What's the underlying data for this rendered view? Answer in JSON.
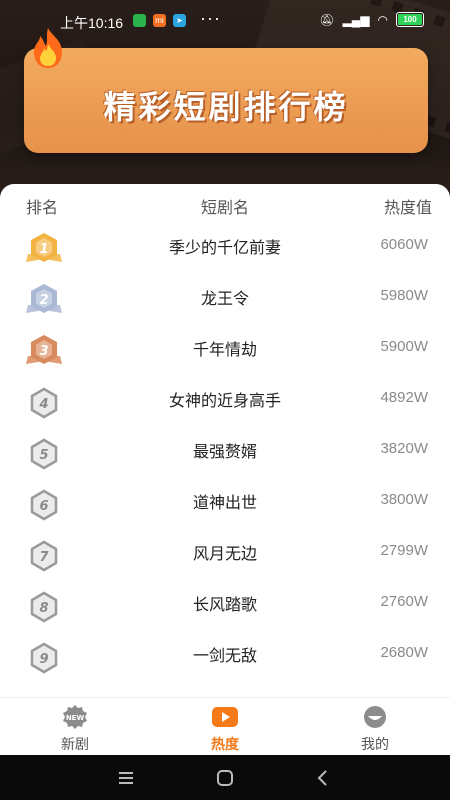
{
  "status_bar": {
    "time": "上午10:16",
    "battery": "100",
    "app_icons": [
      {
        "name": "messages-icon",
        "color": "#2bb24c"
      },
      {
        "name": "mi-icon",
        "color": "#f26f21",
        "text": "mi"
      },
      {
        "name": "telegram-icon",
        "color": "#2aa3e0"
      }
    ],
    "more": "···"
  },
  "banner": {
    "title": "精彩短剧排行榜"
  },
  "table": {
    "headers": {
      "rank": "排名",
      "name": "短剧名",
      "heat": "热度值"
    },
    "rows": [
      {
        "rank": "1",
        "name": "季少的千亿前妻",
        "heat": "6060W",
        "medal": "gold"
      },
      {
        "rank": "2",
        "name": "龙王令",
        "heat": "5980W",
        "medal": "silver"
      },
      {
        "rank": "3",
        "name": "千年情劫",
        "heat": "5900W",
        "medal": "bronze"
      },
      {
        "rank": "4",
        "name": "女神的近身高手",
        "heat": "4892W",
        "medal": "plain"
      },
      {
        "rank": "5",
        "name": "最强赘婿",
        "heat": "3820W",
        "medal": "plain"
      },
      {
        "rank": "6",
        "name": "道神出世",
        "heat": "3800W",
        "medal": "plain"
      },
      {
        "rank": "7",
        "name": "风月无边",
        "heat": "2799W",
        "medal": "plain"
      },
      {
        "rank": "8",
        "name": "长风踏歌",
        "heat": "2760W",
        "medal": "plain"
      },
      {
        "rank": "9",
        "name": "一剑无敌",
        "heat": "2680W",
        "medal": "plain"
      }
    ]
  },
  "tabs": [
    {
      "label": "新剧",
      "icon": "new-badge-icon",
      "active": false
    },
    {
      "label": "热度",
      "icon": "play-icon",
      "active": true
    },
    {
      "label": "我的",
      "icon": "profile-icon",
      "active": false
    }
  ],
  "colors": {
    "accent": "#f57a1a",
    "banner": "#f0a257",
    "gold": "#f3b342",
    "silver": "#aab8d6",
    "bronze": "#d98a5c",
    "plain": "#9a9a9a"
  }
}
